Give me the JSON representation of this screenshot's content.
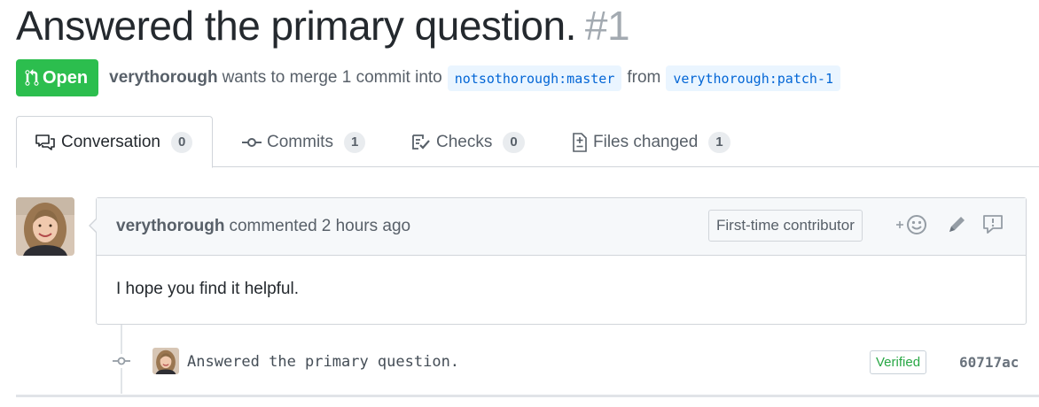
{
  "pr": {
    "title": "Answered the primary question.",
    "number": "#1",
    "state": "Open",
    "author": "verythorough",
    "merge_text": "wants to merge 1 commit into",
    "base_branch": "notsothorough:master",
    "from_text": "from",
    "head_branch": "verythorough:patch-1"
  },
  "tabs": [
    {
      "label": "Conversation",
      "count": "0",
      "icon": "comment-discussion-icon"
    },
    {
      "label": "Commits",
      "count": "1",
      "icon": "git-commit-icon"
    },
    {
      "label": "Checks",
      "count": "0",
      "icon": "checklist-icon"
    },
    {
      "label": "Files changed",
      "count": "1",
      "icon": "file-diff-icon"
    }
  ],
  "comment": {
    "author": "verythorough",
    "action": "commented",
    "time": "2 hours ago",
    "badge": "First-time contributor",
    "body": "I hope you find it helpful."
  },
  "commit": {
    "message": "Answered the primary question.",
    "verified": "Verified",
    "sha": "60717ac"
  },
  "colors": {
    "open_green": "#2cbe4e",
    "link_blue": "#0366d6",
    "verified_green": "#28a745"
  }
}
